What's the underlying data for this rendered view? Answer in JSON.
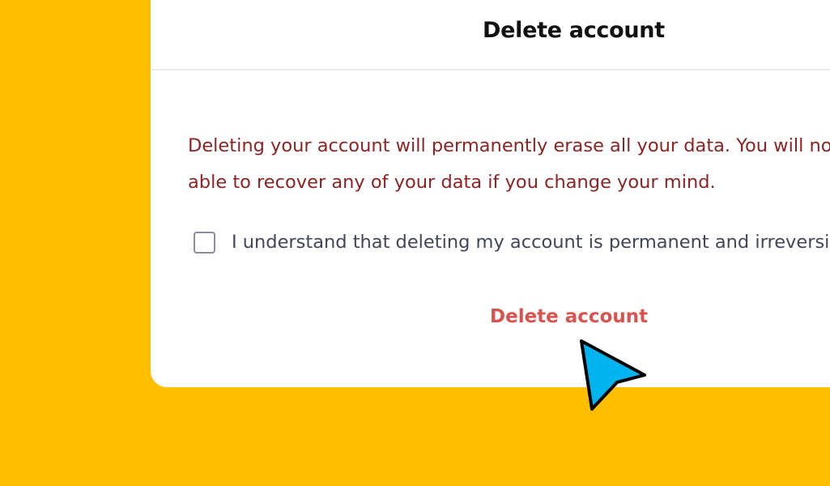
{
  "modal": {
    "title": "Delete account",
    "warning_line1": "Deleting your account will permanently erase all your data. You will not be",
    "warning_line2": "able to recover any of your data if you change your mind.",
    "confirm_label": "I understand that deleting my account is permanent and irreversible.",
    "confirm_checked": false,
    "delete_button_label": "Delete account"
  },
  "colors": {
    "background": "#FFBF00",
    "panel": "#FFFFFF",
    "warning_text": "#8E2323",
    "danger": "#D9534F",
    "cursor": "#00B4F0"
  },
  "icons": {
    "cursor": "mouse-pointer-icon"
  }
}
